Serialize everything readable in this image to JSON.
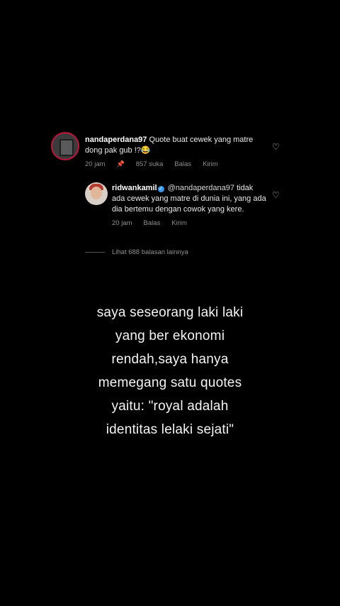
{
  "comment": {
    "username": "nandaperdana97",
    "text": "Quote buat cewek yang matre dong pak gub !?😂",
    "time": "20 jam",
    "likes": "857 suka",
    "reply_label": "Balas",
    "send_label": "Kirim"
  },
  "reply": {
    "username": "ridwankamil",
    "mention": "@nandaperdana97",
    "text": "tidak ada cewek yang matre di dunia ini, yang ada dia bertemu dengan cowok yang kere.",
    "time": "20 jam",
    "reply_label": "Balas",
    "send_label": "Kirim"
  },
  "more_replies": "Lihat 688 balasan lainnya",
  "caption_lines": [
    "saya seseorang laki laki",
    "yang ber ekonomi",
    "rendah,saya hanya",
    "memegang satu quotes",
    "yaitu: \"royal adalah",
    "identitas lelaki sejati\""
  ]
}
